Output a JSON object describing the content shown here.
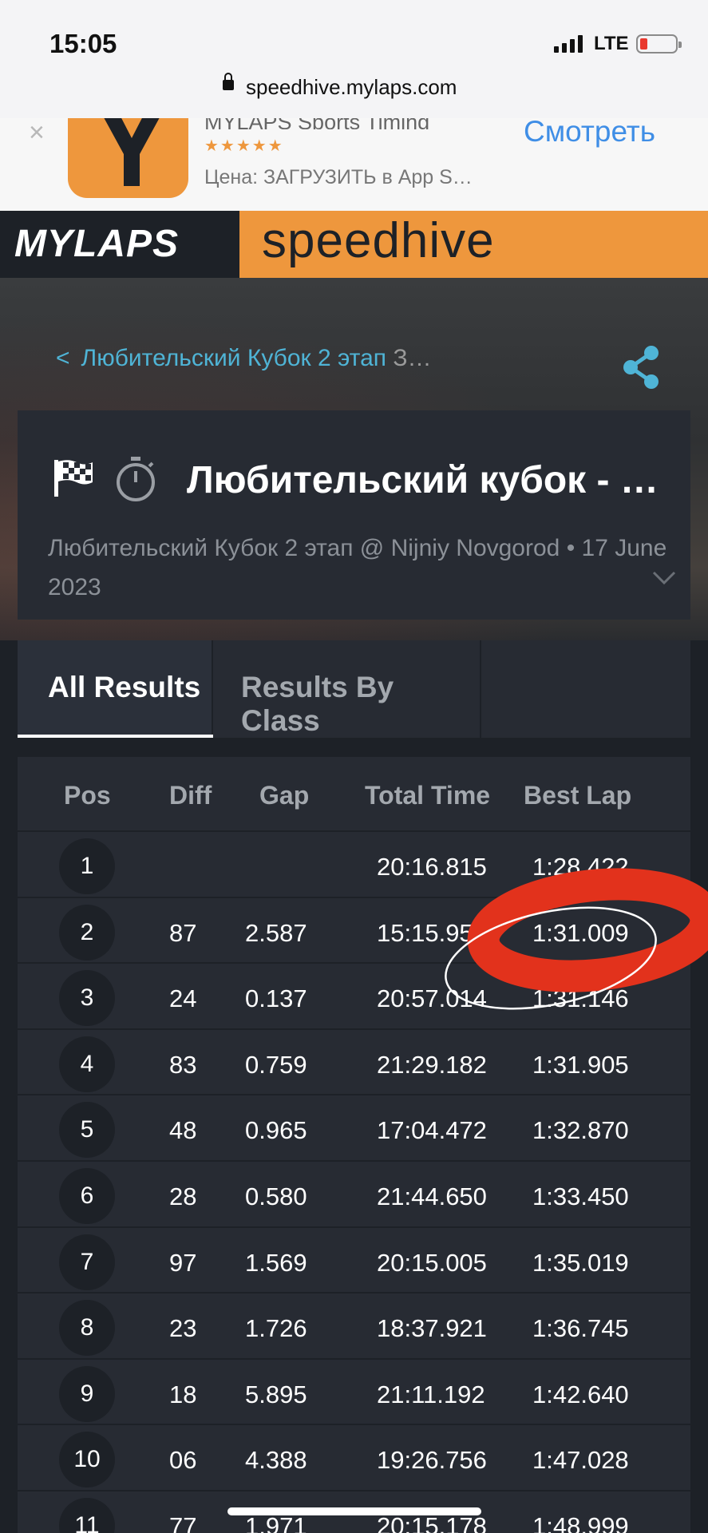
{
  "status_bar": {
    "time": "15:05",
    "network": "LTE"
  },
  "browser": {
    "url": "speedhive.mylaps.com"
  },
  "app_banner": {
    "close": "×",
    "app_name": "MYLAPS Sports Timing",
    "stars": "★★★★★",
    "price": "Цена: ЗАГРУЗИТЬ в App S…",
    "action": "Смотреть"
  },
  "header": {
    "logo": "MYLAPS",
    "product": "speedhive"
  },
  "breadcrumb": {
    "chevron": "<",
    "link": "Любительский Кубок 2 этап",
    "rest": "З…"
  },
  "event": {
    "title": "Любительский кубок - …",
    "subtitle": "Любительский Кубок 2 этап @ Nijniy Novgorod • 17 June 2023"
  },
  "tabs": [
    {
      "label": "All Results",
      "active": true
    },
    {
      "label": "Results By Class",
      "active": false
    }
  ],
  "table": {
    "columns": [
      "Pos",
      "Diff",
      "Gap",
      "Total Time",
      "Best Lap"
    ],
    "rows": [
      {
        "pos": "1",
        "diff": "",
        "gap": "",
        "total": "20:16.815",
        "best": "1:28.422"
      },
      {
        "pos": "2",
        "diff": "87",
        "gap": "2.587",
        "total": "15:15.958",
        "best": "1:31.009"
      },
      {
        "pos": "3",
        "diff": "24",
        "gap": "0.137",
        "total": "20:57.014",
        "best": "1:31.146"
      },
      {
        "pos": "4",
        "diff": "83",
        "gap": "0.759",
        "total": "21:29.182",
        "best": "1:31.905"
      },
      {
        "pos": "5",
        "diff": "48",
        "gap": "0.965",
        "total": "17:04.472",
        "best": "1:32.870"
      },
      {
        "pos": "6",
        "diff": "28",
        "gap": "0.580",
        "total": "21:44.650",
        "best": "1:33.450"
      },
      {
        "pos": "7",
        "diff": "97",
        "gap": "1.569",
        "total": "20:15.005",
        "best": "1:35.019"
      },
      {
        "pos": "8",
        "diff": "23",
        "gap": "1.726",
        "total": "18:37.921",
        "best": "1:36.745"
      },
      {
        "pos": "9",
        "diff": "18",
        "gap": "5.895",
        "total": "21:11.192",
        "best": "1:42.640"
      },
      {
        "pos": "10",
        "diff": "06",
        "gap": "4.388",
        "total": "19:26.756",
        "best": "1:47.028"
      },
      {
        "pos": "11",
        "diff": "77",
        "gap": "1.971",
        "total": "20:15.178",
        "best": "1:48.999"
      }
    ]
  },
  "colors": {
    "accent": "#ee973d",
    "link": "#4fb4d6",
    "annotation": "#e2321c",
    "background": "#1d2127",
    "card": "#272b33"
  }
}
